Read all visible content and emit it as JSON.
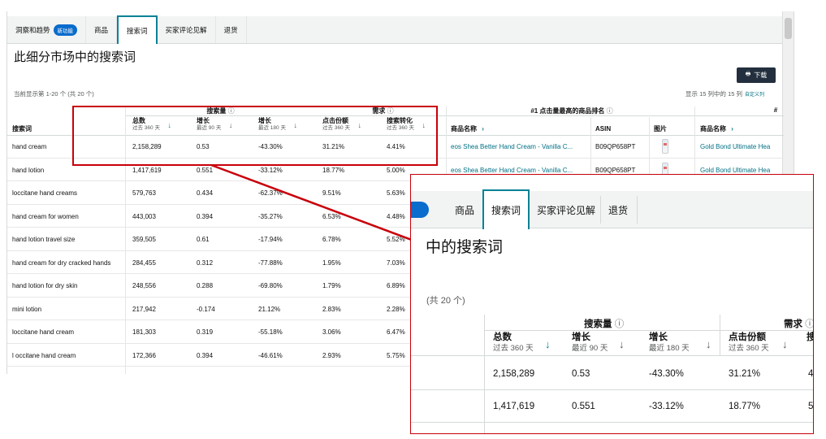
{
  "tabs": [
    {
      "label": "洞察和趋势",
      "badge": "新功能"
    },
    {
      "label": "商品"
    },
    {
      "label": "搜索词"
    },
    {
      "label": "买家评论见解"
    },
    {
      "label": "退货"
    }
  ],
  "page_title": "此细分市场中的搜索词",
  "download_label": "下载",
  "showing_text": "当前显示第 1-20 个 (共 20 个)",
  "columns_info": "显示 15 列中的 15 列",
  "customize_label": "自定义列",
  "groups": {
    "search_volume": "搜索量",
    "demand": "需求",
    "top_product": "#1 点击量最高的商品排名",
    "partial_hash": "#"
  },
  "headers": {
    "search_term": "搜索词",
    "total": {
      "label": "总数",
      "sub": "过去 360 天"
    },
    "growth90": {
      "label": "增长",
      "sub": "最近 90 天"
    },
    "growth180": {
      "label": "增长",
      "sub": "最近 180 天"
    },
    "click_share": {
      "label": "点击份额",
      "sub": "过去 360 天"
    },
    "conversion": {
      "label": "搜索转化",
      "sub": "过去 360 天"
    },
    "product_name": "商品名称",
    "asin": "ASIN",
    "image": "图片",
    "product_name2": "商品名称"
  },
  "rows": [
    {
      "term": "hand cream",
      "total": "2,158,289",
      "g90": "0.53",
      "g180": "-43.30%",
      "share": "31.21%",
      "conv": "4.41%",
      "product": "eos Shea Better Hand Cream - Vanilla C...",
      "asin": "B09QP658PT",
      "product2": "Gold Bond Ultimate Hea"
    },
    {
      "term": "hand lotion",
      "total": "1,417,619",
      "g90": "0.551",
      "g180": "-33.12%",
      "share": "18.77%",
      "conv": "5.00%",
      "product": "eos Shea Better Hand Cream - Vanilla C...",
      "asin": "B09QP658PT",
      "product2": "Gold Bond Ultimate Hea"
    },
    {
      "term": "loccitane hand creams",
      "total": "579,763",
      "g90": "0.434",
      "g180": "-62.37%",
      "share": "9.51%",
      "conv": "5.63%"
    },
    {
      "term": "hand cream for women",
      "total": "443,003",
      "g90": "0.394",
      "g180": "-35.27%",
      "share": "6.53%",
      "conv": "4.48%"
    },
    {
      "term": "hand lotion travel size",
      "total": "359,505",
      "g90": "0.61",
      "g180": "-17.94%",
      "share": "6.78%",
      "conv": "5.52%"
    },
    {
      "term": "hand cream for dry cracked hands",
      "total": "284,455",
      "g90": "0.312",
      "g180": "-77.88%",
      "share": "1.95%",
      "conv": "7.03%"
    },
    {
      "term": "hand lotion for dry skin",
      "total": "248,556",
      "g90": "0.288",
      "g180": "-69.80%",
      "share": "1.79%",
      "conv": "6.89%"
    },
    {
      "term": "mini lotion",
      "total": "217,942",
      "g90": "-0.174",
      "g180": "21.12%",
      "share": "2.83%",
      "conv": "2.28%"
    },
    {
      "term": "loccitane hand cream",
      "total": "181,303",
      "g90": "0.319",
      "g180": "-55.18%",
      "share": "3.06%",
      "conv": "6.47%"
    },
    {
      "term": "l occitane hand cream",
      "total": "172,366",
      "g90": "0.394",
      "g180": "-46.61%",
      "share": "2.93%",
      "conv": "5.75%"
    }
  ],
  "zoom": {
    "tabs": [
      "商品",
      "搜索词",
      "买家评论见解",
      "退货"
    ],
    "title": "中的搜索词",
    "showing": "(共 20 个)",
    "group_search_volume": "搜索量",
    "group_demand": "需求",
    "rows": [
      {
        "total": "2,158,289",
        "g90": "0.53",
        "g180": "-43.30%",
        "share": "31.21%",
        "conv": "4"
      },
      {
        "total": "1,417,619",
        "g90": "0.551",
        "g180": "-33.12%",
        "share": "18.77%",
        "conv": "5"
      }
    ],
    "partial_header": "搜"
  },
  "icons": {
    "help": "ⓘ",
    "sort": "↓",
    "chevron": "›",
    "download": "🖶"
  },
  "colors": {
    "accent": "#008296",
    "link": "#007185",
    "highlight": "#c8000a",
    "badge": "#0a6ccc"
  }
}
